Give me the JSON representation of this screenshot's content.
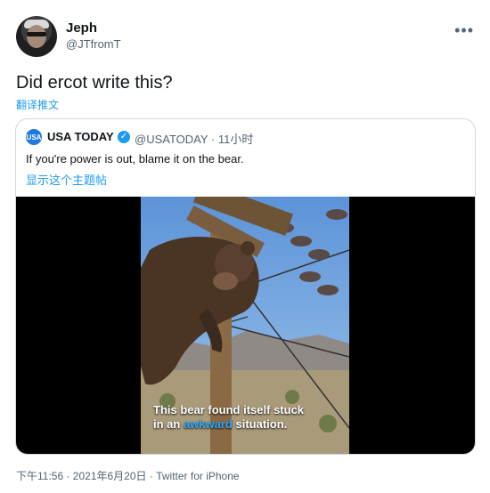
{
  "author": {
    "name": "Jeph",
    "handle": "@JTfromT",
    "more_label": "•••"
  },
  "tweet": {
    "text": "Did ercot write this?",
    "translate_label": "翻译推文"
  },
  "quoted": {
    "logo_text": "USA",
    "name": "USA TODAY",
    "verified_glyph": "✓",
    "handle_time": "@USATODAY · 11小时",
    "text": "If you're power is out, blame it on the bear.",
    "show_thread_label": "显示这个主题帖",
    "video_caption": {
      "line1": "This bear found itself stuck",
      "line2_before": "in an ",
      "line2_highlight": "awkward",
      "line2_after": " situation."
    }
  },
  "footer": {
    "meta": "下午11:56 · 2021年6月20日 · Twitter for iPhone"
  },
  "colors": {
    "accent": "#1d9bf0",
    "secondary_text": "#536471",
    "border": "#cfd9de"
  }
}
